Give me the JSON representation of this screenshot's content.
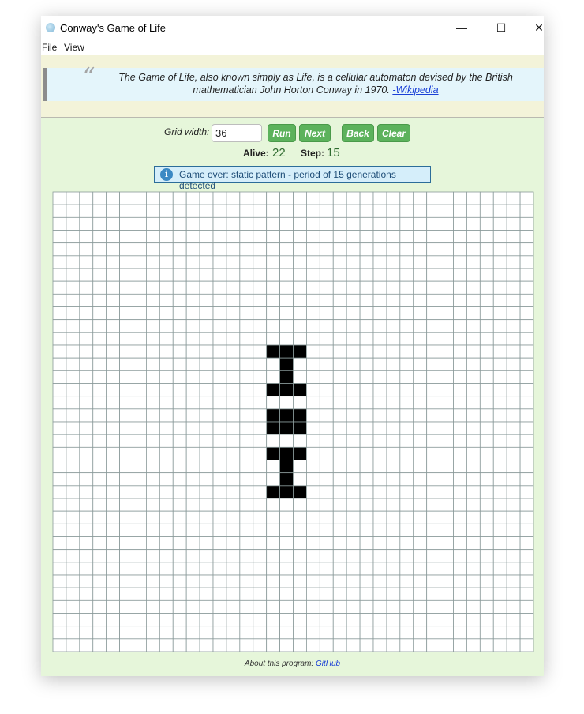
{
  "window": {
    "title": "Conway's Game of Life",
    "controls": [
      "—",
      "☐",
      "✕"
    ]
  },
  "menu": [
    "File",
    "View"
  ],
  "quote": {
    "mark": "“",
    "text": "The Game of Life, also known simply as Life, is a cellular automaton devised by the British mathematician John Horton Conway in 1970. ",
    "link": "-Wikipedia"
  },
  "controls": {
    "grid_width_label": "Grid width:",
    "grid_width_value": "36",
    "run": "Run",
    "next": "Next",
    "back": "Back",
    "clear": "Clear"
  },
  "stats": {
    "alive_label": "Alive:",
    "alive_value": "22",
    "step_label": "Step:",
    "step_value": "15"
  },
  "notice": {
    "icon": "info-icon",
    "text": "Game over: static pattern - period of 15 generations detected"
  },
  "grid": {
    "cols": 36,
    "rows": 36,
    "alive_cells": [
      [
        16,
        12
      ],
      [
        17,
        12
      ],
      [
        18,
        12
      ],
      [
        17,
        13
      ],
      [
        17,
        14
      ],
      [
        16,
        15
      ],
      [
        17,
        15
      ],
      [
        18,
        15
      ],
      [
        16,
        17
      ],
      [
        17,
        17
      ],
      [
        18,
        17
      ],
      [
        16,
        18
      ],
      [
        17,
        18
      ],
      [
        18,
        18
      ],
      [
        16,
        20
      ],
      [
        17,
        20
      ],
      [
        18,
        20
      ],
      [
        17,
        21
      ],
      [
        17,
        22
      ],
      [
        16,
        23
      ],
      [
        17,
        23
      ],
      [
        18,
        23
      ]
    ]
  },
  "footer": {
    "text": "About this program: ",
    "link": "GitHub"
  },
  "colors": {
    "background": "#e6f6da",
    "button": "#5cb25c",
    "alive": "#000000",
    "grid_line": "#8a9a9a"
  }
}
